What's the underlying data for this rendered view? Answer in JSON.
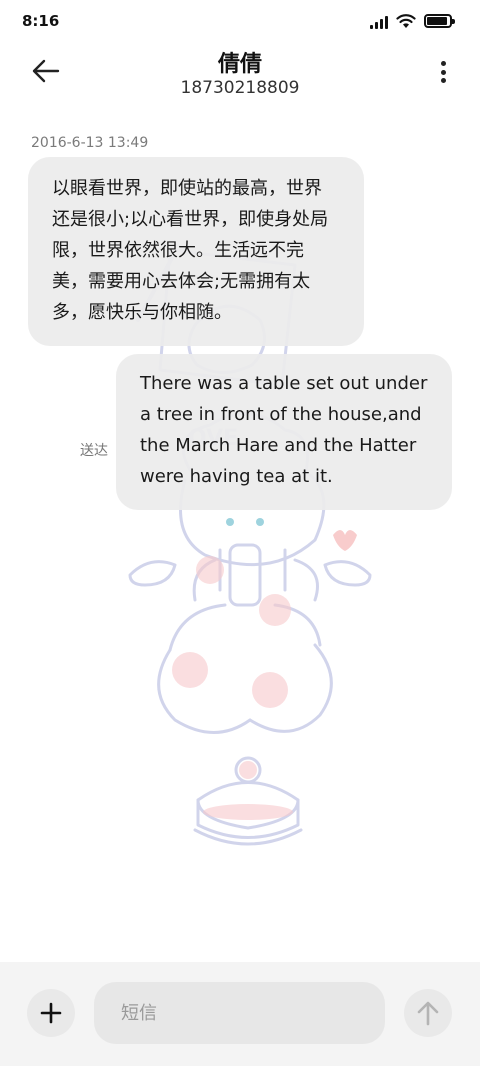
{
  "status_bar": {
    "time": "8:16",
    "battery_level": 0.9
  },
  "header": {
    "contact_name": "倩倩",
    "phone_number": "18730218809"
  },
  "conversation": {
    "timestamp": "2016-6-13 13:49",
    "messages": [
      {
        "direction": "incoming",
        "text": "以眼看世界，即使站的最高，世界还是很小;以心看世界，即使身处局限，世界依然很大。生活远不完美，需要用心去体会;无需拥有太多，愿快乐与你相随。"
      },
      {
        "direction": "outgoing",
        "text": "There was a table set out under a tree in front of the house,and the March Hare and the Hatter were having tea at it.",
        "status": "送达"
      }
    ]
  },
  "composer": {
    "placeholder": "短信"
  },
  "icons": {
    "back": "arrow-left-icon",
    "more": "more-vertical-icon",
    "add": "plus-icon",
    "send": "arrow-up-icon"
  }
}
